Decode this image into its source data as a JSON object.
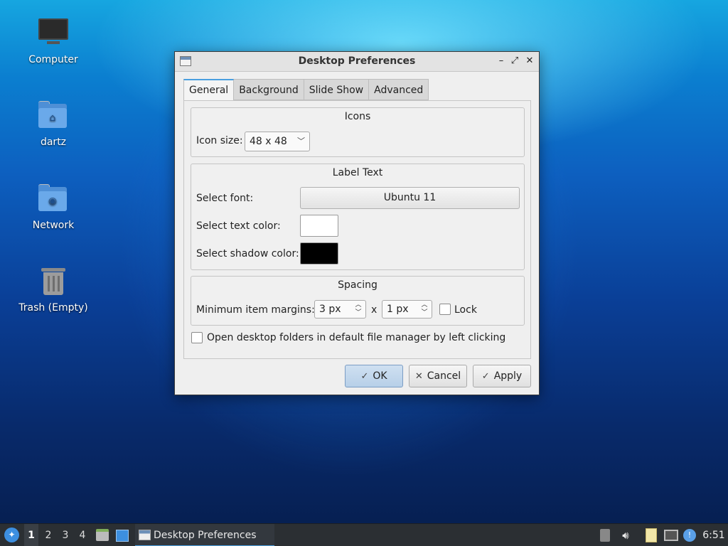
{
  "desktop": {
    "icons": [
      {
        "label": "Computer",
        "icon": "monitor-icon"
      },
      {
        "label": "dartz",
        "icon": "home-folder-icon"
      },
      {
        "label": "Network",
        "icon": "network-folder-icon"
      },
      {
        "label": "Trash (Empty)",
        "icon": "trash-icon"
      }
    ]
  },
  "dialog": {
    "title": "Desktop Preferences",
    "tabs": [
      "General",
      "Background",
      "Slide Show",
      "Advanced"
    ],
    "active_tab": "General",
    "icons_group": {
      "title": "Icons",
      "icon_size_label": "Icon size:",
      "icon_size_value": "48 x 48"
    },
    "label_text_group": {
      "title": "Label Text",
      "font_label": "Select font:",
      "font_value": "Ubuntu 11",
      "text_color_label": "Select text color:",
      "text_color": "#ffffff",
      "shadow_color_label": "Select shadow color:",
      "shadow_color": "#000000"
    },
    "spacing_group": {
      "title": "Spacing",
      "margins_label": "Minimum item margins:",
      "margin_x": "3 px",
      "separator": "x",
      "margin_y": "1 px",
      "lock_label": "Lock",
      "lock_checked": false
    },
    "open_folders_label": "Open desktop folders in default file manager by left clicking",
    "open_folders_checked": false,
    "buttons": {
      "ok": "OK",
      "cancel": "Cancel",
      "apply": "Apply"
    }
  },
  "taskbar": {
    "workspaces": [
      "1",
      "2",
      "3",
      "4"
    ],
    "active_workspace": "1",
    "task_label": "Desktop Preferences",
    "clock": "6:51"
  },
  "colors": {
    "accent": "#4a9fe0",
    "taskbar_bg": "#2b2f33"
  }
}
